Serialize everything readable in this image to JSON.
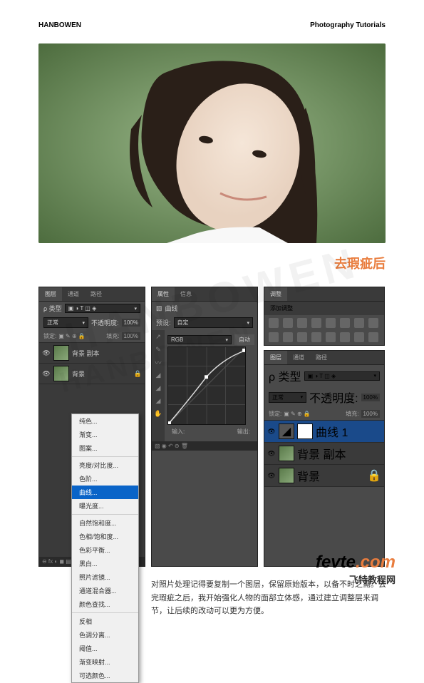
{
  "header": {
    "left": "HANBOWEN",
    "right": "Photography Tutorials"
  },
  "watermark": "HANBOWEN",
  "caption": "去瑕疵后",
  "layers_panel": {
    "tabs": [
      "图层",
      "通道",
      "路径"
    ],
    "kind_label": "ρ 类型",
    "blend": "正常",
    "opacity_label": "不透明度:",
    "opacity": "100%",
    "lock_label": "锁定:",
    "fill_label": "填充:",
    "fill": "100%",
    "items": [
      {
        "name": "背景 副本"
      },
      {
        "name": "背景"
      }
    ]
  },
  "context_menu": {
    "groups": [
      [
        "纯色...",
        "渐变...",
        "图案..."
      ],
      [
        "亮度/对比度...",
        "色阶...",
        "曲线...",
        "曝光度..."
      ],
      [
        "自然饱和度...",
        "色相/饱和度...",
        "色彩平衡...",
        "黑白...",
        "照片滤镜...",
        "通道混合器...",
        "颜色查找..."
      ],
      [
        "反相",
        "色调分离...",
        "阈值...",
        "渐变映射...",
        "可选颜色..."
      ]
    ],
    "highlight": "曲线..."
  },
  "curves_panel": {
    "tabs": [
      "属性",
      "信息"
    ],
    "title": "曲线",
    "preset_label": "预设:",
    "preset": "自定",
    "channel": "RGB",
    "auto": "自动",
    "input": "输入:",
    "output": "输出:"
  },
  "adjustments": {
    "tab": "调整",
    "title": "添加调整"
  },
  "layers2": {
    "tabs": [
      "图层",
      "通道",
      "路径"
    ],
    "kind_label": "ρ 类型",
    "blend": "正常",
    "opacity_label": "不透明度:",
    "opacity": "100%",
    "lock_label": "锁定:",
    "fill_label": "填充:",
    "fill": "100%",
    "items": [
      {
        "name": "曲线 1"
      },
      {
        "name": "背景 副本"
      },
      {
        "name": "背景"
      }
    ]
  },
  "body_text": "对照片处理记得要复制一个图层，保留原始版本，以备不时之需。去完瑕疵之后，我开始强化人物的面部立体感，通过建立调整层来调节，让后续的改动可以更为方便。",
  "logo": {
    "main1": "fevte",
    "main2": ".com",
    "sub": "飞特教程网"
  }
}
